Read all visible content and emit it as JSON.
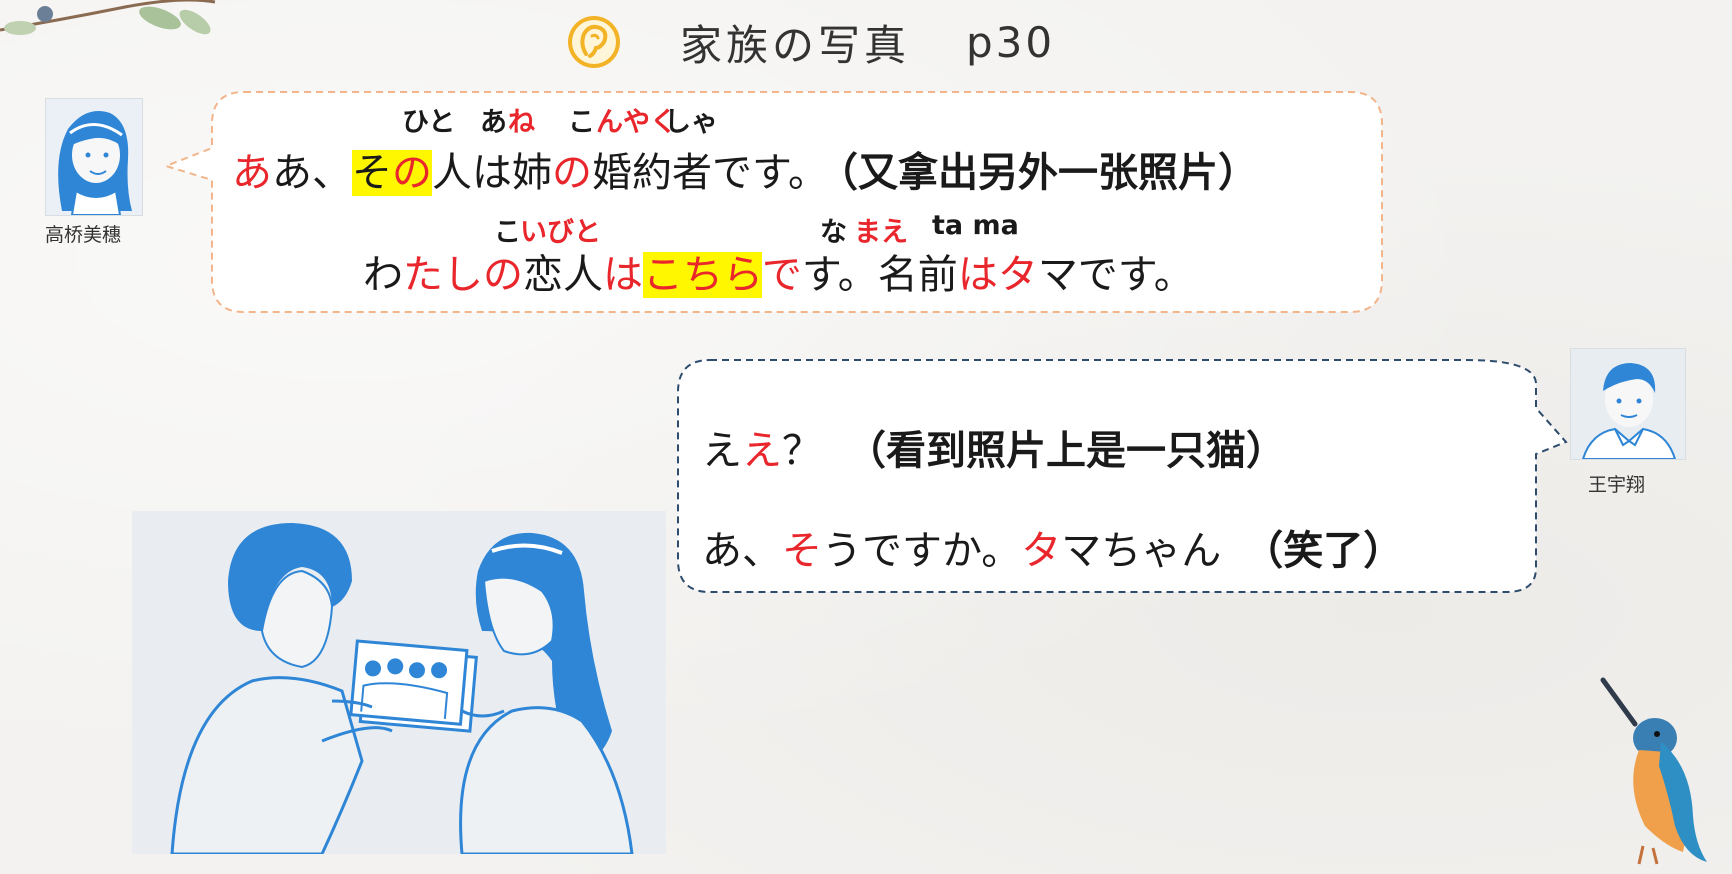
{
  "header": {
    "title": "家族の写真",
    "page": "p30",
    "icon": "ear-speech-icon"
  },
  "colors": {
    "accent_red": "#e8262b",
    "highlight_yellow": "#fff700",
    "avatar_blue": "#2f86d6",
    "bubble1_border": "#f2b48a",
    "bubble2_border": "#2e4c6d"
  },
  "speakers": {
    "left_name": "高桥美穗",
    "right_name": "王宇翔"
  },
  "bubble1": {
    "ruby1": {
      "hito": "ひと",
      "ane_a": "あ",
      "ane_ne": "ね",
      "kon": "こ",
      "nyaku": "んやく",
      "sha": "しゃ"
    },
    "line1": {
      "s1": "あ",
      "s2": "あ、",
      "s3": "その",
      "s4": "人は姉",
      "s5": "の",
      "s6": "婚約者です。",
      "cn": "（又拿出另外一张照片）"
    },
    "ruby2": {
      "ko": "こ",
      "ibito": "いびと",
      "na": "な",
      "mae": "まえ",
      "tama": "ta ma"
    },
    "line2": {
      "s1": "わ",
      "s2": "たしの",
      "s3": "恋人",
      "s4": "は",
      "s5": "こちら",
      "s6": "で",
      "s7": "す。名前",
      "s8": "は",
      "s9": "タ",
      "s10": "マです。"
    }
  },
  "bubble2": {
    "line1": {
      "s1": "え",
      "s2": "え",
      "s3": "？",
      "cn": "（看到照片上是一只猫）"
    },
    "line2": {
      "s1": "あ、",
      "s2": "そ",
      "s3": "うですか。",
      "s4": "タ",
      "s5": "マちゃん",
      "cn": "（笑了）"
    }
  },
  "images": {
    "illustration": "couple-looking-at-photo",
    "decor_top": "branch-with-leaves",
    "decor_bottom": "kingfisher-bird"
  }
}
